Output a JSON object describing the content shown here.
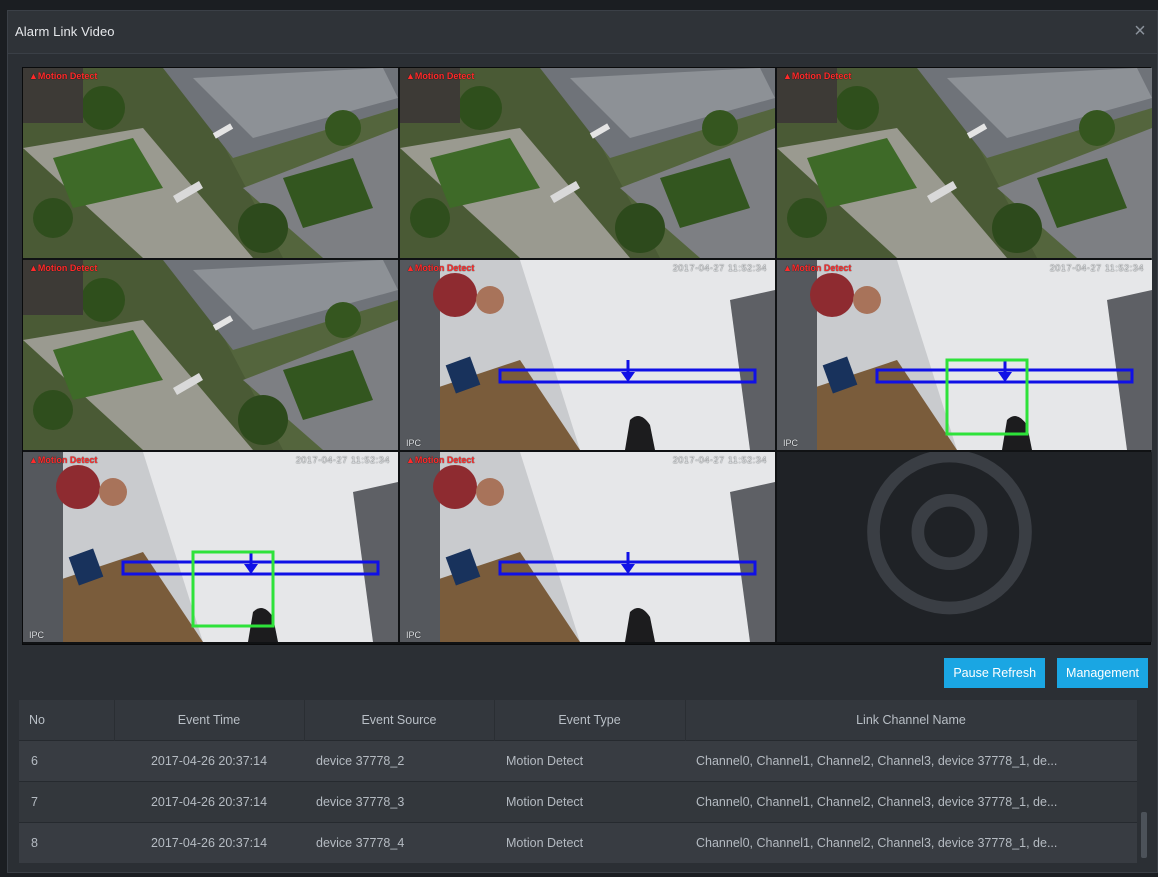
{
  "window": {
    "title": "Alarm Link Video",
    "close_glyph": "×"
  },
  "video": {
    "accent": "#2aa7dc",
    "tiles": [
      {
        "scene": "aerial",
        "tag": "▲Motion Detect",
        "time": "",
        "ipc": "",
        "boxed": false,
        "selected": true
      },
      {
        "scene": "aerial",
        "tag": "▲Motion Detect",
        "time": "",
        "ipc": "",
        "boxed": false,
        "selected": false
      },
      {
        "scene": "aerial",
        "tag": "▲Motion Detect",
        "time": "",
        "ipc": "",
        "boxed": false,
        "selected": false
      },
      {
        "scene": "aerial",
        "tag": "▲Motion Detect",
        "time": "",
        "ipc": "",
        "boxed": false,
        "selected": false
      },
      {
        "scene": "indoor",
        "tag": "▲Motion Detect",
        "time": "2017-04-27 11:52:34",
        "ipc": "IPC",
        "boxed": false,
        "selected": false
      },
      {
        "scene": "indoor",
        "tag": "▲Motion Detect",
        "time": "2017-04-27 11:52:34",
        "ipc": "IPC",
        "boxed": true,
        "selected": false
      },
      {
        "scene": "indoor",
        "tag": "▲Motion Detect",
        "time": "2017-04-27 11:52:34",
        "ipc": "IPC",
        "boxed": true,
        "selected": false
      },
      {
        "scene": "indoor",
        "tag": "▲Motion Detect",
        "time": "2017-04-27 11:52:34",
        "ipc": "IPC",
        "boxed": false,
        "selected": false
      },
      {
        "scene": "empty",
        "tag": "",
        "time": "",
        "ipc": "",
        "boxed": false,
        "selected": false,
        "icon": "camera-placeholder-icon"
      }
    ]
  },
  "actions": {
    "pause_refresh": "Pause Refresh",
    "management": "Management",
    "button_color": "#1aa6e3"
  },
  "table": {
    "columns": [
      "No",
      "Event Time",
      "Event Source",
      "Event Type",
      "Link Channel Name"
    ],
    "rows": [
      {
        "no": "6",
        "time": "2017-04-26 20:37:14",
        "source": "device 37778_2",
        "type": "Motion Detect",
        "channels": "Channel0, Channel1, Channel2, Channel3, device 37778_1, de..."
      },
      {
        "no": "7",
        "time": "2017-04-26 20:37:14",
        "source": "device 37778_3",
        "type": "Motion Detect",
        "channels": "Channel0, Channel1, Channel2, Channel3, device 37778_1, de..."
      },
      {
        "no": "8",
        "time": "2017-04-26 20:37:14",
        "source": "device 37778_4",
        "type": "Motion Detect",
        "channels": "Channel0, Channel1, Channel2, Channel3, device 37778_1, de..."
      }
    ]
  }
}
